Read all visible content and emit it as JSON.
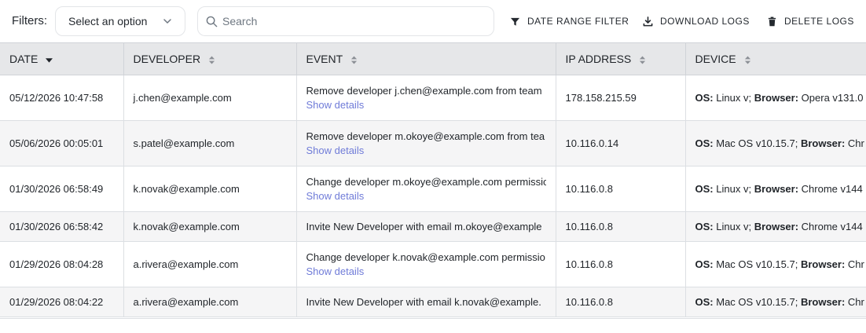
{
  "toolbar": {
    "filters_label": "Filters:",
    "select_value": "Select an option",
    "search_placeholder": "Search",
    "date_range_label": "DATE RANGE FILTER",
    "download_label": "DOWNLOAD LOGS",
    "delete_label": "DELETE LOGS"
  },
  "table": {
    "headers": {
      "date": "DATE",
      "developer": "DEVELOPER",
      "event": "EVENT",
      "ip": "IP ADDRESS",
      "device": "DEVICE"
    },
    "os_label": "OS:",
    "browser_label": "Browser:",
    "details_label": "Show details",
    "rows": [
      {
        "date": "05/12/2026 10:47:58",
        "developer": "j.chen@example.com",
        "event": "Remove developer j.chen@example.com from team",
        "ip": "178.158.215.59",
        "os": "Linux v;",
        "browser": "Opera v131.0"
      },
      {
        "date": "05/06/2026 00:05:01",
        "developer": "s.patel@example.com",
        "event": "Remove developer m.okoye@example.com from tea",
        "ip": "10.116.0.14",
        "os": "Mac OS v10.15.7;",
        "browser": "Chr"
      },
      {
        "date": "01/30/2026 06:58:49",
        "developer": "k.novak@example.com",
        "event": "Change developer m.okoye@example.com permissio",
        "ip": "10.116.0.8",
        "os": "Linux v;",
        "browser": "Chrome v144"
      },
      {
        "date": "01/30/2026 06:58:42",
        "developer": "k.novak@example.com",
        "event": "Invite New Developer with email m.okoye@example",
        "ip": "10.116.0.8",
        "os": "Linux v;",
        "browser": "Chrome v144"
      },
      {
        "date": "01/29/2026 08:04:28",
        "developer": "a.rivera@example.com",
        "event": "Change developer k.novak@example.com permissio",
        "ip": "10.116.0.8",
        "os": "Mac OS v10.15.7;",
        "browser": "Chr"
      },
      {
        "date": "01/29/2026 08:04:22",
        "developer": "a.rivera@example.com",
        "event": "Invite New Developer with email k.novak@example.",
        "ip": "10.116.0.8",
        "os": "Mac OS v10.15.7;",
        "browser": "Chr"
      }
    ]
  }
}
